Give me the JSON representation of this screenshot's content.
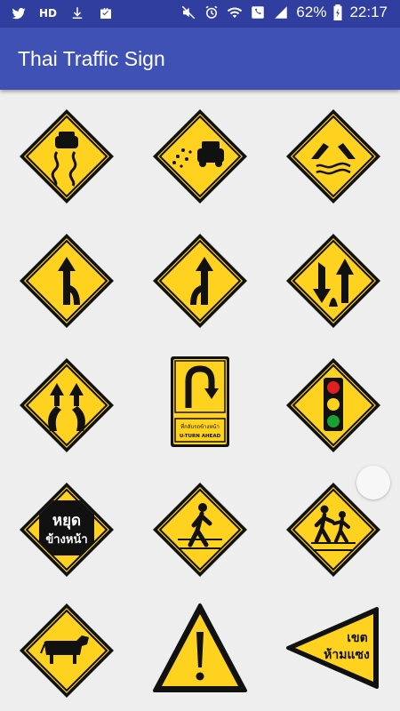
{
  "status_bar": {
    "hd_label": "HD",
    "battery_percent": "62%",
    "time": "22:17",
    "icons": [
      "twitter-icon",
      "hd-icon",
      "download-icon",
      "briefcase-icon",
      "mute-icon",
      "alarm-icon",
      "wifi-icon",
      "call-icon",
      "signal-icon",
      "battery-icon"
    ]
  },
  "app_bar": {
    "title": "Thai Traffic Sign",
    "color": "#3f51b5",
    "status_color": "#303f9f"
  },
  "signs": [
    {
      "name": "slippery-road-sign",
      "icon": "slippery-road-icon"
    },
    {
      "name": "loose-gravel-sign",
      "icon": "gravel-car-icon"
    },
    {
      "name": "bridge-over-water-sign",
      "icon": "bridge-icon"
    },
    {
      "name": "merge-from-right-sign",
      "icon": "merge-right-icon"
    },
    {
      "name": "merge-from-left-sign",
      "icon": "merge-left-icon"
    },
    {
      "name": "two-way-traffic-sign",
      "icon": "two-way-icon"
    },
    {
      "name": "divided-road-sign",
      "icon": "divided-road-icon"
    },
    {
      "name": "u-turn-ahead-sign",
      "icon": "u-turn-icon",
      "text_thai": "ที่กลับรถข้างหน้า",
      "text_en": "U-TURN AHEAD"
    },
    {
      "name": "traffic-light-sign",
      "icon": "traffic-light-icon"
    },
    {
      "name": "stop-ahead-sign",
      "icon": "stop-octagon-icon",
      "text_line1": "หยุด",
      "text_line2": "ข้างหน้า"
    },
    {
      "name": "pedestrian-crossing-sign",
      "icon": "pedestrian-icon"
    },
    {
      "name": "school-crossing-sign",
      "icon": "children-icon"
    },
    {
      "name": "cattle-crossing-sign",
      "icon": "cow-icon"
    },
    {
      "name": "caution-exclamation-sign",
      "icon": "exclamation-icon"
    },
    {
      "name": "end-no-passing-sign",
      "icon": "pennant-icon",
      "text_line1": "เขต",
      "text_line2": "ห้ามแซง"
    }
  ],
  "colors": {
    "sign_yellow": "#ffd21f",
    "sign_black": "#111111"
  }
}
